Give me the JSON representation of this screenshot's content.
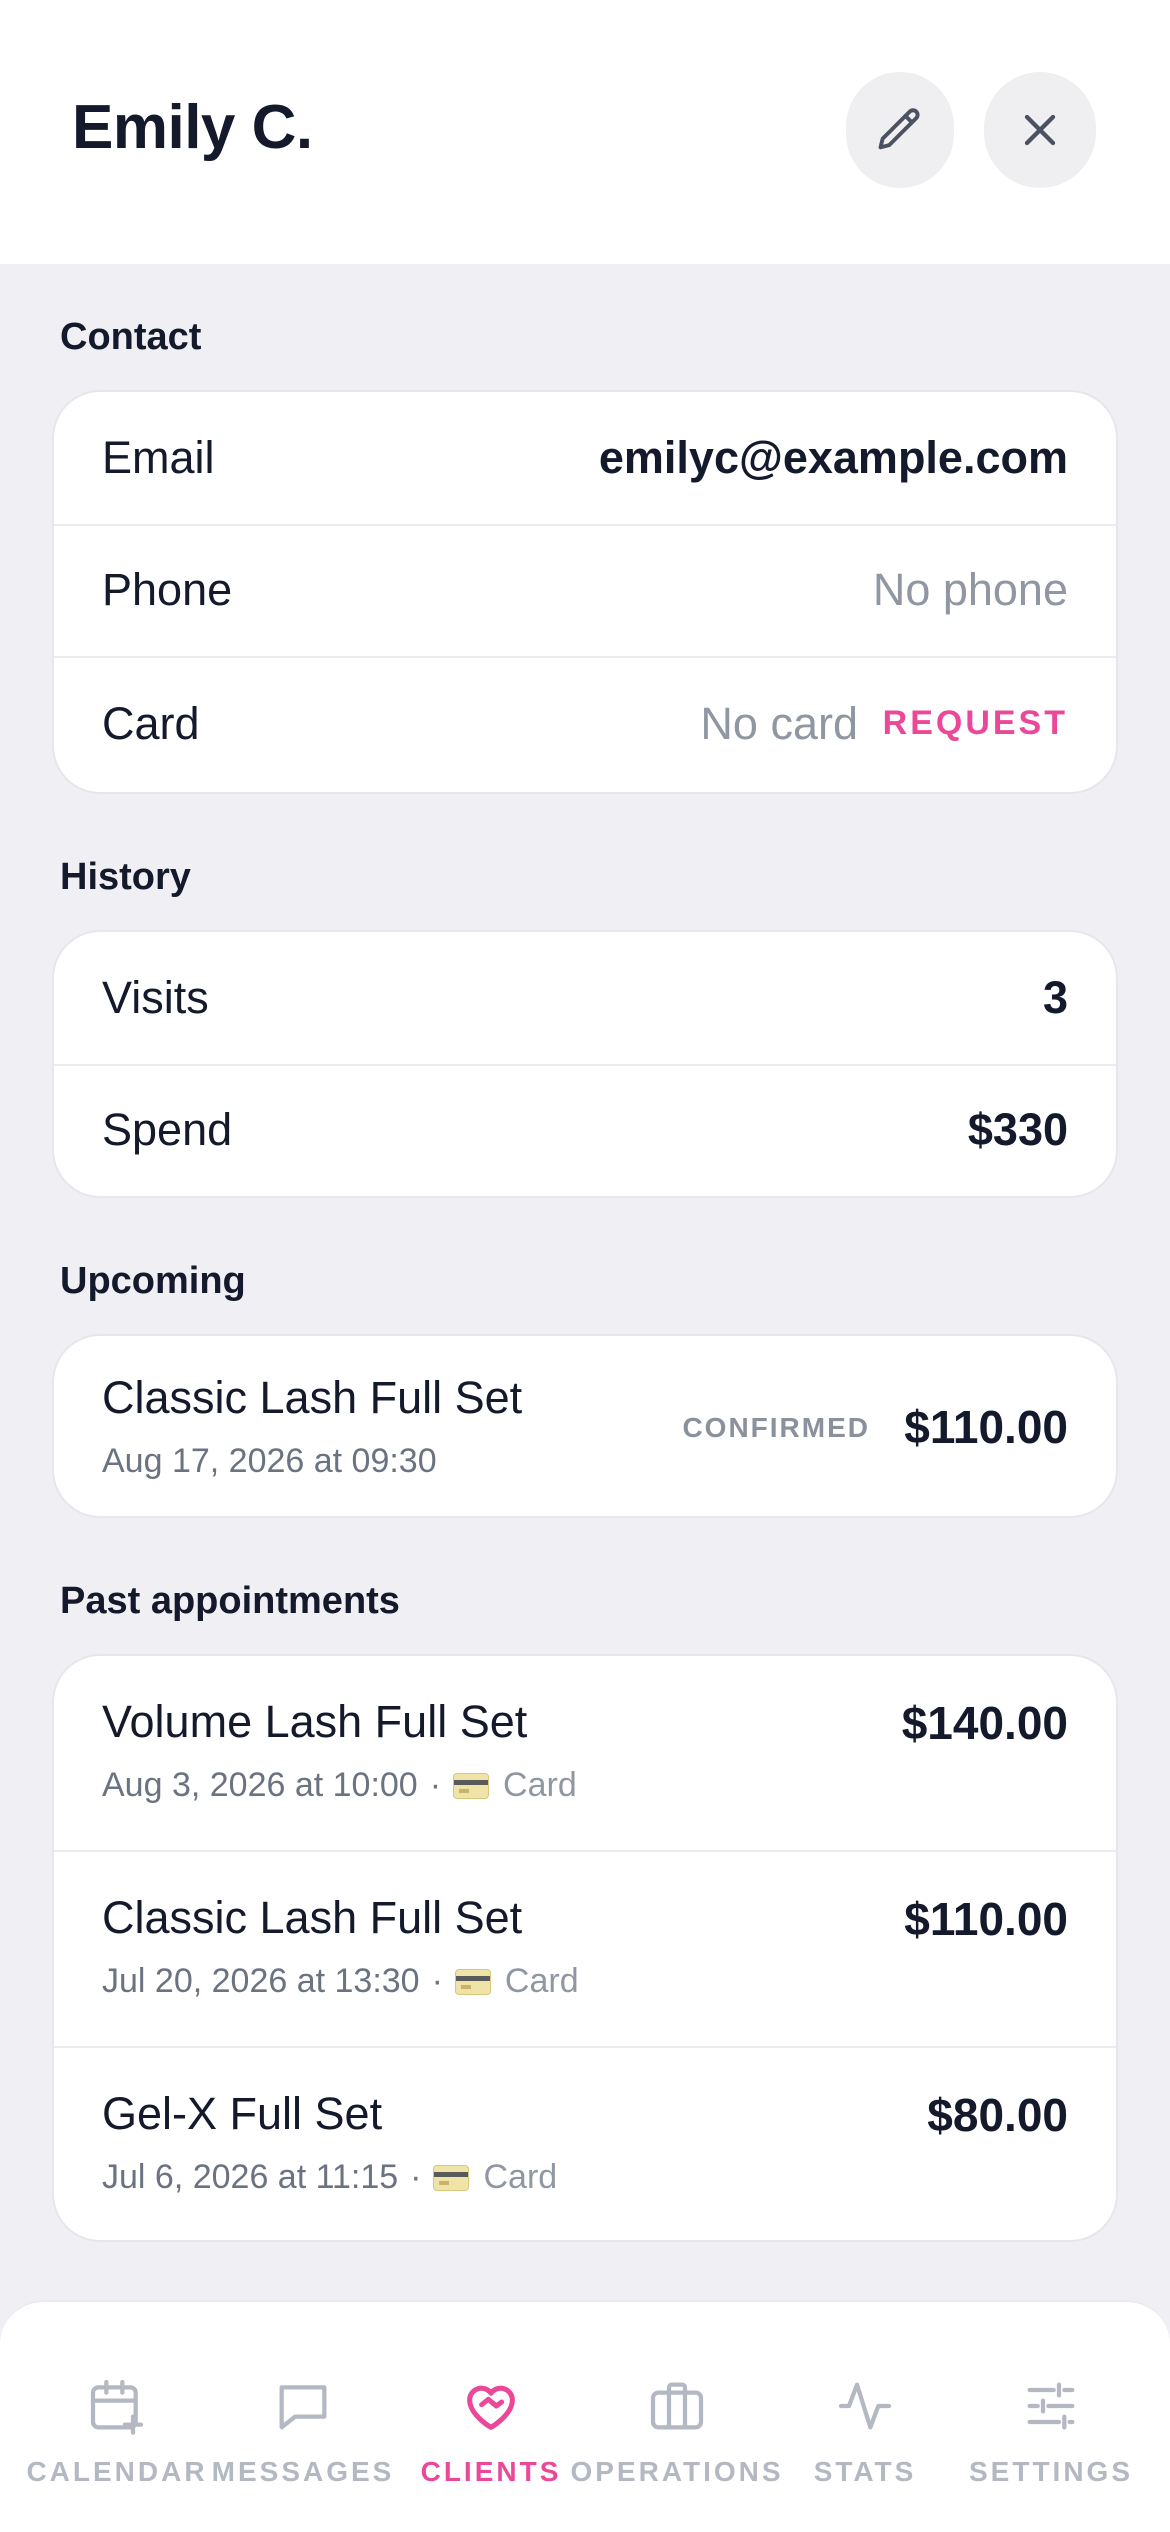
{
  "header": {
    "title": "Emily C."
  },
  "contact": {
    "section_label": "Contact",
    "email_label": "Email",
    "email_value": "emilyc@example.com",
    "phone_label": "Phone",
    "phone_value": "No phone",
    "card_label": "Card",
    "card_value": "No card",
    "request_label": "REQUEST"
  },
  "history": {
    "section_label": "History",
    "visits_label": "Visits",
    "visits_value": "3",
    "spend_label": "Spend",
    "spend_value": "$330"
  },
  "upcoming": {
    "section_label": "Upcoming",
    "items": [
      {
        "title": "Classic Lash Full Set",
        "datetime": "Aug 17, 2026 at 09:30",
        "status": "CONFIRMED",
        "price": "$110.00"
      }
    ]
  },
  "past": {
    "section_label": "Past appointments",
    "items": [
      {
        "title": "Volume Lash Full Set",
        "datetime": "Aug 3, 2026 at 10:00",
        "separator": "·",
        "payment": "Card",
        "price": "$140.00"
      },
      {
        "title": "Classic Lash Full Set",
        "datetime": "Jul 20, 2026 at 13:30",
        "separator": "·",
        "payment": "Card",
        "price": "$110.00"
      },
      {
        "title": "Gel-X Full Set",
        "datetime": "Jul 6, 2026 at 11:15",
        "separator": "·",
        "payment": "Card",
        "price": "$80.00"
      }
    ]
  },
  "nav": {
    "items": [
      {
        "label": "CALENDAR",
        "icon": "calendar-plus-icon"
      },
      {
        "label": "MESSAGES",
        "icon": "message-icon"
      },
      {
        "label": "CLIENTS",
        "icon": "heart-handshake-icon",
        "active": true
      },
      {
        "label": "OPERATIONS",
        "icon": "briefcase-icon"
      },
      {
        "label": "STATS",
        "icon": "activity-icon"
      },
      {
        "label": "SETTINGS",
        "icon": "sliders-icon"
      }
    ]
  },
  "colors": {
    "accent": "#ec4899",
    "text": "#141a2c",
    "muted": "#9097a3",
    "background": "#f0f0f4"
  }
}
